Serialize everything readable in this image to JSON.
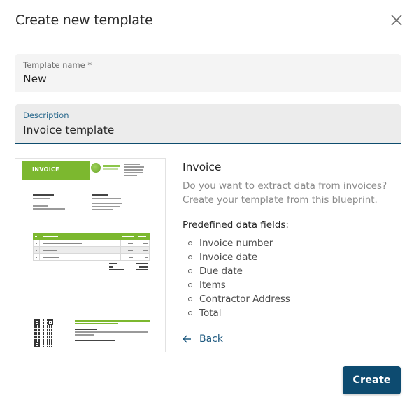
{
  "dialog": {
    "title": "Create new template",
    "close_icon": "close-icon"
  },
  "form": {
    "template_name": {
      "label": "Template name *",
      "value": "New"
    },
    "description": {
      "label": "Description",
      "value": "Invoice template"
    }
  },
  "preview": {
    "document_title": "INVOICE",
    "accent_color": "#7cb82f"
  },
  "blueprint": {
    "title": "Invoice",
    "description_line1": "Do you want to extract data from invoices?",
    "description_line2": "Create your template from this blueprint.",
    "fields_heading": "Predefined data fields:",
    "fields": [
      "Invoice number",
      "Invoice date",
      "Due date",
      "Items",
      "Contractor Address",
      "Total"
    ],
    "back_label": "Back"
  },
  "actions": {
    "create_label": "Create",
    "primary_color": "#0d4b70"
  }
}
